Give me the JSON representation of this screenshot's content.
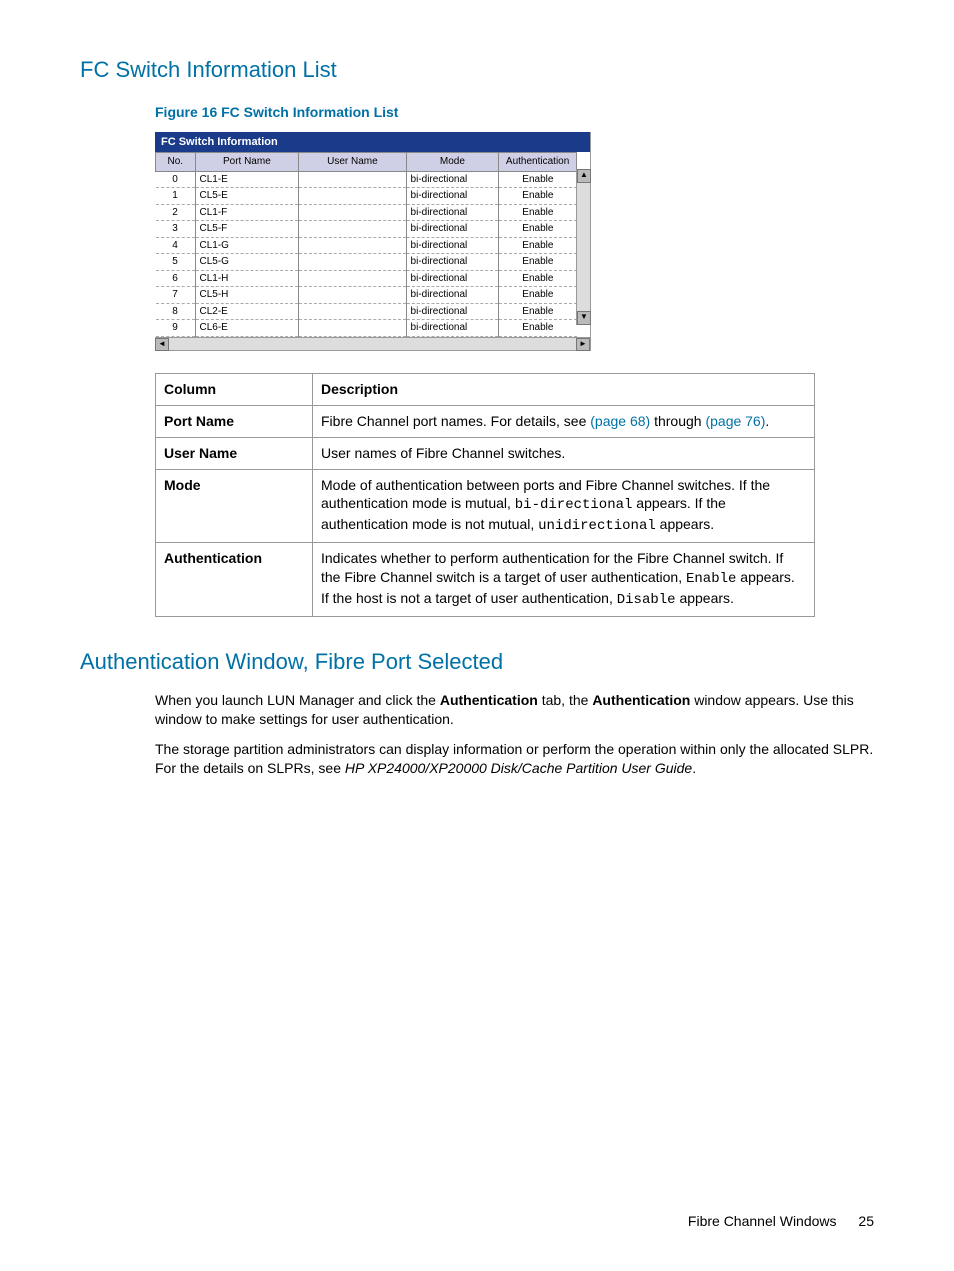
{
  "section1_title": "FC Switch Information List",
  "figure_caption": "Figure 16 FC Switch Information List",
  "fc_box_title": "FC Switch Information",
  "fc_columns": [
    "No.",
    "Port Name",
    "User Name",
    "Mode",
    "Authentication"
  ],
  "fc_rows": [
    {
      "no": "0",
      "port": "CL1-E",
      "user": "",
      "mode": "bi-directional",
      "auth": "Enable"
    },
    {
      "no": "1",
      "port": "CL5-E",
      "user": "",
      "mode": "bi-directional",
      "auth": "Enable"
    },
    {
      "no": "2",
      "port": "CL1-F",
      "user": "",
      "mode": "bi-directional",
      "auth": "Enable"
    },
    {
      "no": "3",
      "port": "CL5-F",
      "user": "",
      "mode": "bi-directional",
      "auth": "Enable"
    },
    {
      "no": "4",
      "port": "CL1-G",
      "user": "",
      "mode": "bi-directional",
      "auth": "Enable"
    },
    {
      "no": "5",
      "port": "CL5-G",
      "user": "",
      "mode": "bi-directional",
      "auth": "Enable"
    },
    {
      "no": "6",
      "port": "CL1-H",
      "user": "",
      "mode": "bi-directional",
      "auth": "Enable"
    },
    {
      "no": "7",
      "port": "CL5-H",
      "user": "",
      "mode": "bi-directional",
      "auth": "Enable"
    },
    {
      "no": "8",
      "port": "CL2-E",
      "user": "",
      "mode": "bi-directional",
      "auth": "Enable"
    },
    {
      "no": "9",
      "port": "CL6-E",
      "user": "",
      "mode": "bi-directional",
      "auth": "Enable"
    }
  ],
  "desc_header": {
    "col": "Column",
    "desc": "Description"
  },
  "desc_rows": {
    "port": {
      "label": "Port Name",
      "t1": "Fibre Channel port names. For details, see ",
      "link1": "(page 68)",
      "t2": " through ",
      "link2": "(page 76)",
      "t3": "."
    },
    "user": {
      "label": "User Name",
      "text": "User names of Fibre Channel switches."
    },
    "mode": {
      "label": "Mode",
      "t1": "Mode of authentication between ports and Fibre Channel switches. If the authentication mode is mutual, ",
      "c1": "bi-directional",
      "t2": " appears. If the authentication mode is not mutual, ",
      "c2": "unidirectional",
      "t3": " appears."
    },
    "auth": {
      "label": "Authentication",
      "t1": "Indicates whether to perform authentication for the Fibre Channel switch. If the Fibre Channel switch is a target of user authentication, ",
      "c1": "Enable",
      "t2": " appears. If the host is not a target of user authentication, ",
      "c2": "Disable",
      "t3": " appears."
    }
  },
  "section2_title": "Authentication Window, Fibre Port Selected",
  "para1": {
    "t1": "When you launch LUN Manager and click the ",
    "b1": "Authentication",
    "t2": " tab, the ",
    "b2": "Authentication",
    "t3": " window appears. Use this window to make settings for user authentication."
  },
  "para2": {
    "t1": "The storage partition administrators can display information or perform the operation within only the allocated SLPR. For the details on SLPRs, see ",
    "i1": "HP XP24000/XP20000 Disk/Cache Partition User Guide",
    "t2": "."
  },
  "footer_text": "Fibre Channel Windows",
  "footer_page": "25"
}
